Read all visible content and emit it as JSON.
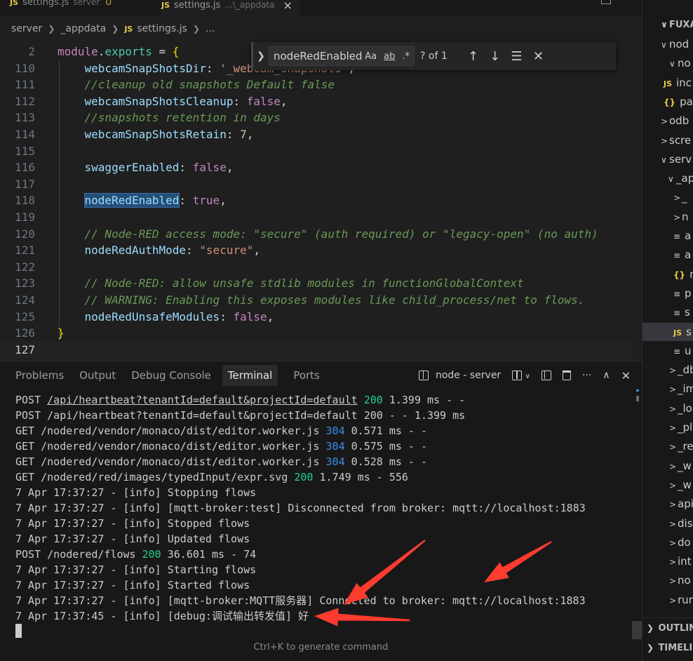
{
  "tabs": [
    {
      "label": "settings.js",
      "desc": "server",
      "badge": "U"
    },
    {
      "label": "settings.js",
      "desc": "...\\_appdata",
      "close": "×"
    }
  ],
  "breadcrumb": [
    "server",
    "_appdata",
    "settings.js",
    "..."
  ],
  "editor": {
    "lines": [
      {
        "n": "2",
        "parts": [
          [
            "k-kw",
            "module"
          ],
          [
            "k-plain",
            "."
          ],
          [
            "k-obj",
            "exports"
          ],
          [
            "k-plain",
            " = "
          ],
          [
            "k-brace",
            "{"
          ]
        ]
      },
      {
        "n": "110",
        "parts": [
          [
            "k-plain",
            "    "
          ],
          [
            "k-prop",
            "webcamSnapShotsDir"
          ],
          [
            "k-plain",
            ": "
          ],
          [
            "k-str",
            "'_webcam_snapshots'"
          ],
          [
            "k-plain",
            ","
          ]
        ]
      },
      {
        "n": "111",
        "parts": [
          [
            "k-plain",
            "    "
          ],
          [
            "k-cm",
            "//cleanup old snapshots Default false"
          ]
        ]
      },
      {
        "n": "112",
        "parts": [
          [
            "k-plain",
            "    "
          ],
          [
            "k-prop",
            "webcamSnapShotsCleanup"
          ],
          [
            "k-plain",
            ": "
          ],
          [
            "k-kw",
            "false"
          ],
          [
            "k-plain",
            ","
          ]
        ]
      },
      {
        "n": "113",
        "parts": [
          [
            "k-plain",
            "    "
          ],
          [
            "k-cm",
            "//snapshots retention in days"
          ]
        ]
      },
      {
        "n": "114",
        "parts": [
          [
            "k-plain",
            "    "
          ],
          [
            "k-prop",
            "webcamSnapShotsRetain"
          ],
          [
            "k-plain",
            ": "
          ],
          [
            "k-num",
            "7"
          ],
          [
            "k-plain",
            ","
          ]
        ]
      },
      {
        "n": "115",
        "parts": []
      },
      {
        "n": "116",
        "parts": [
          [
            "k-plain",
            "    "
          ],
          [
            "k-prop",
            "swaggerEnabled"
          ],
          [
            "k-plain",
            ": "
          ],
          [
            "k-kw",
            "false"
          ],
          [
            "k-plain",
            ","
          ]
        ]
      },
      {
        "n": "117",
        "parts": []
      },
      {
        "n": "118",
        "parts": [
          [
            "k-plain",
            "    "
          ],
          [
            "k-prop hl",
            "nodeRedEnabled"
          ],
          [
            "k-plain",
            ": "
          ],
          [
            "k-kw",
            "true"
          ],
          [
            "k-plain",
            ","
          ]
        ]
      },
      {
        "n": "119",
        "parts": []
      },
      {
        "n": "120",
        "parts": [
          [
            "k-plain",
            "    "
          ],
          [
            "k-cm",
            "// Node-RED access mode: \"secure\" (auth required) or \"legacy-open\" (no auth)"
          ]
        ]
      },
      {
        "n": "121",
        "parts": [
          [
            "k-plain",
            "    "
          ],
          [
            "k-prop",
            "nodeRedAuthMode"
          ],
          [
            "k-plain",
            ": "
          ],
          [
            "k-str",
            "\"secure\""
          ],
          [
            "k-plain",
            ","
          ]
        ]
      },
      {
        "n": "122",
        "parts": []
      },
      {
        "n": "123",
        "parts": [
          [
            "k-plain",
            "    "
          ],
          [
            "k-cm",
            "// Node-RED: allow unsafe stdlib modules in functionGlobalContext"
          ]
        ]
      },
      {
        "n": "124",
        "parts": [
          [
            "k-plain",
            "    "
          ],
          [
            "k-cm",
            "// WARNING: Enabling this exposes modules like child_process/net to flows."
          ]
        ]
      },
      {
        "n": "125",
        "parts": [
          [
            "k-plain",
            "    "
          ],
          [
            "k-prop",
            "nodeRedUnsafeModules"
          ],
          [
            "k-plain",
            ": "
          ],
          [
            "k-kw",
            "false"
          ],
          [
            "k-plain",
            ","
          ]
        ]
      },
      {
        "n": "126",
        "parts": [
          [
            "k-brace",
            "}"
          ]
        ]
      },
      {
        "n": "127",
        "parts": []
      }
    ]
  },
  "find": {
    "query": "nodeRedEnabled",
    "opt_case": "Aa",
    "opt_word": "ab",
    "opt_regex": ".*",
    "count": "? of 1"
  },
  "panel": {
    "tabs": [
      "Problems",
      "Output",
      "Debug Console",
      "Terminal",
      "Ports"
    ],
    "terminal_name": "node - server",
    "hint": "Ctrl+K to generate command"
  },
  "terminal": [
    [
      [
        "",
        "POST "
      ],
      [
        "t-ul",
        "/api/heartbeat?tenantId=default&projectId=default"
      ],
      [
        "t-green",
        " 200"
      ],
      [
        "",
        " 1.399 ms - -"
      ]
    ],
    [
      [
        "",
        "POST /api/heartbeat?tenantId=default&projectId=default 200 - - 1.399 ms"
      ]
    ],
    [
      [
        "",
        "GET /nodered/vendor/monaco/dist/editor.worker.js "
      ],
      [
        "t-blue",
        "304"
      ],
      [
        "",
        " 0.571 ms - -"
      ]
    ],
    [
      [
        "",
        "GET /nodered/vendor/monaco/dist/editor.worker.js "
      ],
      [
        "t-blue",
        "304"
      ],
      [
        "",
        " 0.575 ms - -"
      ]
    ],
    [
      [
        "",
        "GET /nodered/vendor/monaco/dist/editor.worker.js "
      ],
      [
        "t-blue",
        "304"
      ],
      [
        "",
        " 0.528 ms - -"
      ]
    ],
    [
      [
        "",
        "GET /nodered/red/images/typedInput/expr.svg "
      ],
      [
        "t-green",
        "200"
      ],
      [
        "",
        " 1.749 ms - 556"
      ]
    ],
    [
      [
        "",
        "7 Apr 17:37:27 - [info] Stopping flows"
      ]
    ],
    [
      [
        "",
        "7 Apr 17:37:27 - [info] [mqtt-broker:test] Disconnected from broker: mqtt://localhost:1883"
      ]
    ],
    [
      [
        "",
        "7 Apr 17:37:27 - [info] Stopped flows"
      ]
    ],
    [
      [
        "",
        "7 Apr 17:37:27 - [info] Updated flows"
      ]
    ],
    [
      [
        "",
        "POST /nodered/flows "
      ],
      [
        "t-green",
        "200"
      ],
      [
        "",
        " 36.601 ms - 74"
      ]
    ],
    [
      [
        "",
        "7 Apr 17:37:27 - [info] Starting flows"
      ]
    ],
    [
      [
        "",
        "7 Apr 17:37:27 - [info] Started flows"
      ]
    ],
    [
      [
        "",
        "7 Apr 17:37:27 - [info] [mqtt-broker:MQTT服务器] Connected to broker: mqtt://localhost:1883"
      ]
    ],
    [
      [
        "",
        "7 Apr 17:37:45 - [info] [debug:调试输出转发值] 好"
      ]
    ]
  ],
  "explorer": {
    "items": [
      {
        "t": "FUXA-M",
        "kind": "hdr",
        "ch": "∨"
      },
      {
        "t": "nod",
        "kind": "folder",
        "ch": "∨"
      },
      {
        "t": "no",
        "kind": "folder",
        "ch": "∨"
      },
      {
        "t": "inc",
        "kind": "js"
      },
      {
        "t": "pac",
        "kind": "json"
      },
      {
        "t": "odb",
        "kind": "folder",
        "ch": ">"
      },
      {
        "t": "scre",
        "kind": "folder",
        "ch": ">"
      },
      {
        "t": "serv",
        "kind": "folder",
        "ch": "∨"
      },
      {
        "t": "_ap",
        "kind": "folder",
        "ch": "∨"
      },
      {
        "t": "_",
        "kind": "folder",
        "ch": ">"
      },
      {
        "t": "n",
        "kind": "folder",
        "ch": ">"
      },
      {
        "t": "a",
        "kind": "file"
      },
      {
        "t": "a",
        "kind": "file"
      },
      {
        "t": "m",
        "kind": "json"
      },
      {
        "t": "p",
        "kind": "file"
      },
      {
        "t": "s",
        "kind": "file"
      },
      {
        "t": "s",
        "kind": "js",
        "sel": true
      },
      {
        "t": "u",
        "kind": "file"
      },
      {
        "t": "_db",
        "kind": "folder",
        "ch": ">"
      },
      {
        "t": "_im",
        "kind": "folder",
        "ch": ">"
      },
      {
        "t": "_lo",
        "kind": "folder",
        "ch": ">"
      },
      {
        "t": "_pl",
        "kind": "folder",
        "ch": ">"
      },
      {
        "t": "_re",
        "kind": "folder",
        "ch": ">"
      },
      {
        "t": "_w",
        "kind": "folder",
        "ch": ">"
      },
      {
        "t": "_w",
        "kind": "folder",
        "ch": ">"
      },
      {
        "t": "api",
        "kind": "folder",
        "ch": ">"
      },
      {
        "t": "dis",
        "kind": "folder",
        "ch": ">"
      },
      {
        "t": "do",
        "kind": "folder",
        "ch": ">"
      },
      {
        "t": "int",
        "kind": "folder",
        "ch": ">"
      },
      {
        "t": "no",
        "kind": "folder",
        "ch": ">"
      },
      {
        "t": "rur",
        "kind": "folder",
        "ch": ">"
      }
    ],
    "outline": "OUTLIN",
    "timeline": "TIMELI"
  },
  "colors": {
    "annotation_arrow": "#ff3b30",
    "accent": "#0078d4"
  }
}
